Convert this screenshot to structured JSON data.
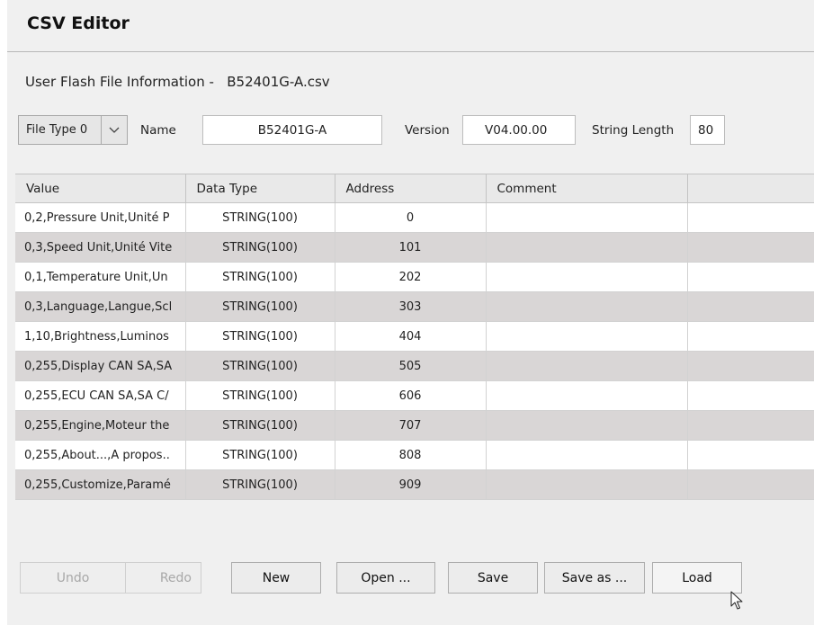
{
  "window": {
    "title": "CSV Editor"
  },
  "file_info": {
    "label": "User Flash File Information -",
    "filename": "B52401G-A.csv"
  },
  "form": {
    "file_type_value": "File Type 0",
    "name_label": "Name",
    "name_value": "B52401G-A",
    "version_label": "Version",
    "version_value": "V04.00.00",
    "string_length_label": "String Length",
    "string_length_value": "80"
  },
  "table": {
    "columns": [
      "Value",
      "Data Type",
      "Address",
      "Comment",
      ""
    ],
    "rows": [
      {
        "value": "0,2,Pressure Unit,Unité P",
        "data_type": "STRING(100)",
        "address": "0",
        "comment": ""
      },
      {
        "value": "0,3,Speed Unit,Unité Vite",
        "data_type": "STRING(100)",
        "address": "101",
        "comment": ""
      },
      {
        "value": "0,1,Temperature Unit,Un",
        "data_type": "STRING(100)",
        "address": "202",
        "comment": ""
      },
      {
        "value": "0,3,Language,Langue,Scl",
        "data_type": "STRING(100)",
        "address": "303",
        "comment": ""
      },
      {
        "value": "1,10,Brightness,Luminos",
        "data_type": "STRING(100)",
        "address": "404",
        "comment": ""
      },
      {
        "value": "0,255,Display CAN SA,SA",
        "data_type": "STRING(100)",
        "address": "505",
        "comment": ""
      },
      {
        "value": "0,255,ECU CAN SA,SA C/",
        "data_type": "STRING(100)",
        "address": "606",
        "comment": ""
      },
      {
        "value": "0,255,Engine,Moteur the",
        "data_type": "STRING(100)",
        "address": "707",
        "comment": ""
      },
      {
        "value": "0,255,About...,A propos..",
        "data_type": "STRING(100)",
        "address": "808",
        "comment": ""
      },
      {
        "value": "0,255,Customize,Paramé",
        "data_type": "STRING(100)",
        "address": "909",
        "comment": ""
      }
    ]
  },
  "buttons": {
    "undo": "Undo",
    "redo": "Redo",
    "new": "New",
    "open": "Open ...",
    "save": "Save",
    "save_as": "Save as ...",
    "load": "Load"
  },
  "colors": {
    "background": "#f0f0f0",
    "row_alt": "#d9d6d6",
    "disabled_text": "#a8a8a8"
  },
  "icons": {
    "dropdown": "chevron-down-icon",
    "cursor": "mouse-pointer-icon"
  }
}
